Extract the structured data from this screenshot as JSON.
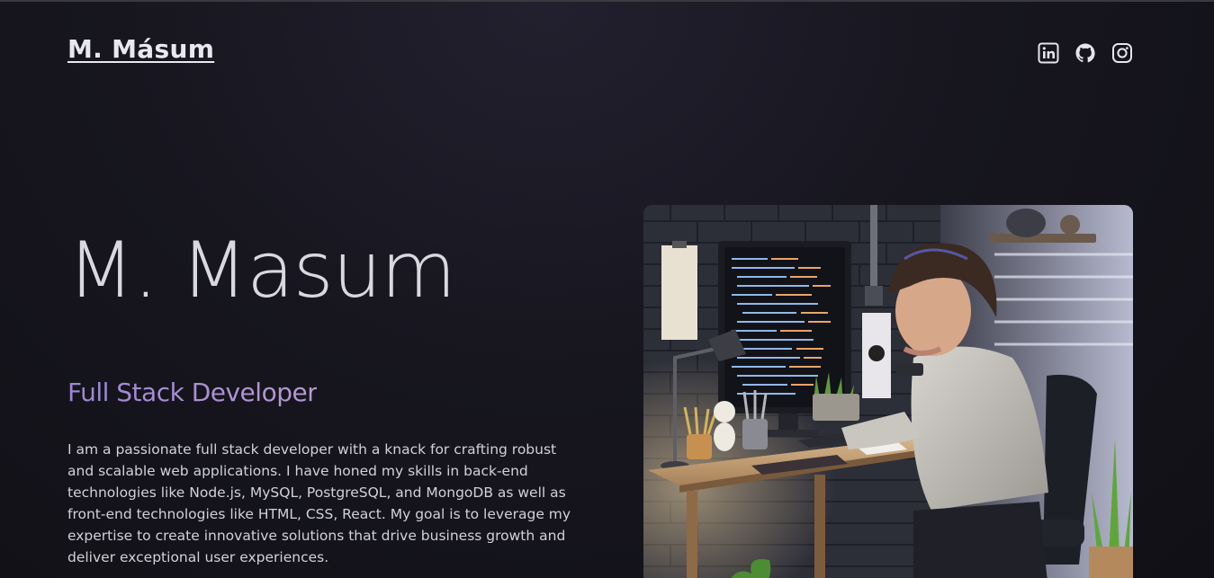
{
  "header": {
    "logo": "M. Másum",
    "social_links": [
      {
        "icon": "linkedin-icon"
      },
      {
        "icon": "github-icon"
      },
      {
        "icon": "instagram-icon"
      }
    ]
  },
  "hero": {
    "name": "M. Masum",
    "role": "Full Stack Developer",
    "bio": "I am a passionate full stack developer with a knack for crafting robust and scalable web applications. I have honed my skills in back-end technologies like Node.js, MySQL, PostgreSQL, and MongoDB as well as front-end technologies like HTML, CSS, React. My goal is to leverage my expertise to create innovative solutions that drive business growth and deliver exceptional user experiences.",
    "image": "developer-at-desk-illustration"
  },
  "colors": {
    "background": "#121117",
    "role_gradient_start": "#9c86d4",
    "role_gradient_end": "#b69ad0",
    "text": "#e8e6ee"
  }
}
